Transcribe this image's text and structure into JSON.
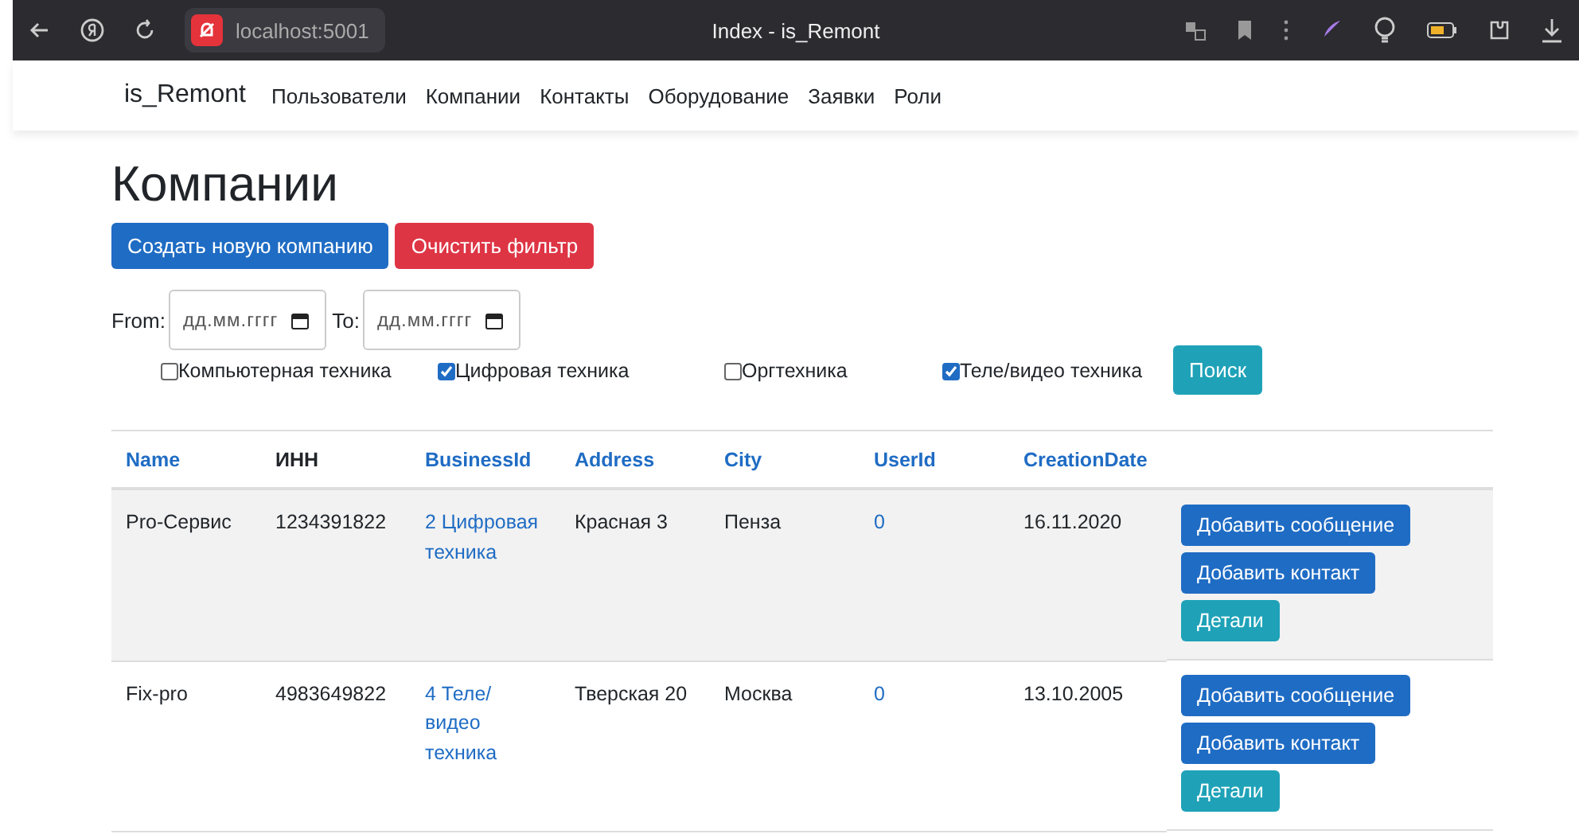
{
  "browser": {
    "url": "localhost:5001",
    "title": "Index - is_Remont"
  },
  "navbar": {
    "brand": "is_Remont",
    "items": [
      {
        "label": "Пользователи"
      },
      {
        "label": "Компании"
      },
      {
        "label": "Контакты"
      },
      {
        "label": "Оборудование"
      },
      {
        "label": "Заявки"
      },
      {
        "label": "Роли"
      }
    ]
  },
  "heading": "Компании",
  "actions": [
    {
      "label": "Создать новую компанию",
      "kind": "primary"
    },
    {
      "label": "Очистить фильтр",
      "kind": "danger"
    }
  ],
  "filter": {
    "from_label": "From:",
    "from_placeholder": "дд.мм.гггг",
    "to_label": "To:",
    "to_placeholder": "дд.мм.гггг",
    "categories": [
      {
        "label": "Компьютерная техника",
        "checked": false
      },
      {
        "label": "Цифровая техника",
        "checked": true
      },
      {
        "label": "Оргтехника",
        "checked": false
      },
      {
        "label": "Теле/видео техника",
        "checked": true
      }
    ],
    "search_button": "Поиск"
  },
  "table": {
    "columns": [
      {
        "label": "Name",
        "link": true
      },
      {
        "label": "ИНН",
        "link": false
      },
      {
        "label": "BusinessId",
        "link": true
      },
      {
        "label": "Address",
        "link": true
      },
      {
        "label": "City",
        "link": true
      },
      {
        "label": "UserId",
        "link": true
      },
      {
        "label": "CreationDate",
        "link": true
      }
    ],
    "rows": [
      {
        "cells": [
          {
            "text": "Pro-Сервис",
            "link": false
          },
          {
            "text": "1234391822",
            "link": false
          },
          {
            "text": "2 Цифровая техника",
            "link": true
          },
          {
            "text": "Красная 3",
            "link": false
          },
          {
            "text": "Пенза",
            "link": false
          },
          {
            "text": "0",
            "link": true
          },
          {
            "text": "16.11.2020",
            "link": false
          }
        ],
        "buttons": [
          {
            "label": "Добавить сообщение",
            "kind": "primary"
          },
          {
            "label": "Добавить контакт",
            "kind": "primary"
          },
          {
            "label": "Детали",
            "kind": "info"
          }
        ]
      },
      {
        "cells": [
          {
            "text": "Fix-pro",
            "link": false
          },
          {
            "text": "4983649822",
            "link": false
          },
          {
            "text": "4 Теле/видео техника",
            "link": true
          },
          {
            "text": "Тверская 20",
            "link": false
          },
          {
            "text": "Москва",
            "link": false
          },
          {
            "text": "0",
            "link": true
          },
          {
            "text": "13.10.2005",
            "link": false
          }
        ],
        "buttons": [
          {
            "label": "Добавить сообщение",
            "kind": "primary"
          },
          {
            "label": "Добавить контакт",
            "kind": "primary"
          },
          {
            "label": "Детали",
            "kind": "info"
          }
        ]
      }
    ]
  }
}
